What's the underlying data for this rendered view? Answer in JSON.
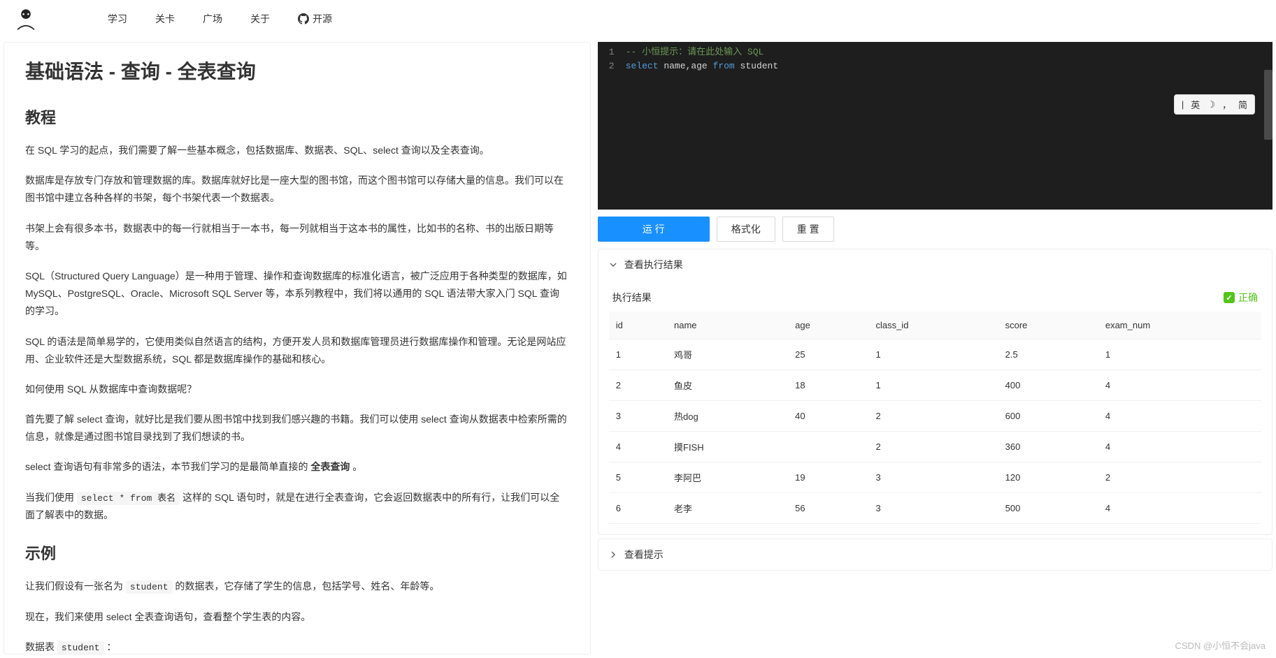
{
  "nav": {
    "links": [
      "学习",
      "关卡",
      "广场",
      "关于"
    ],
    "github": "开源"
  },
  "tutorial": {
    "title": "基础语法 - 查询 - 全表查询",
    "section1": "教程",
    "p1": "在 SQL 学习的起点，我们需要了解一些基本概念，包括数据库、数据表、SQL、select 查询以及全表查询。",
    "p2": "数据库是存放专门存放和管理数据的库。数据库就好比是一座大型的图书馆，而这个图书馆可以存储大量的信息。我们可以在图书馆中建立各种各样的书架，每个书架代表一个数据表。",
    "p3": "书架上会有很多本书，数据表中的每一行就相当于一本书，每一列就相当于这本书的属性，比如书的名称、书的出版日期等等。",
    "p4": "SQL（Structured Query Language）是一种用于管理、操作和查询数据库的标准化语言，被广泛应用于各种类型的数据库，如 MySQL、PostgreSQL、Oracle、Microsoft SQL Server 等，本系列教程中，我们将以通用的 SQL 语法带大家入门 SQL 查询的学习。",
    "p5": "SQL 的语法是简单易学的，它使用类似自然语言的结构，方便开发人员和数据库管理员进行数据库操作和管理。无论是网站应用、企业软件还是大型数据系统，SQL 都是数据库操作的基础和核心。",
    "p6": "如何使用 SQL 从数据库中查询数据呢？",
    "p7": "首先要了解 select 查询，就好比是我们要从图书馆中找到我们感兴趣的书籍。我们可以使用 select 查询从数据表中检索所需的信息，就像是通过图书馆目录找到了我们想读的书。",
    "p8_prefix": "select 查询语句有非常多的语法，本节我们学习的是最简单直接的 ",
    "p8_bold": "全表查询",
    "p8_suffix": " 。",
    "p9_prefix": "当我们使用 ",
    "p9_code": "select * from 表名",
    "p9_suffix": " 这样的 SQL 语句时，就是在进行全表查询，它会返回数据表中的所有行，让我们可以全面了解表中的数据。",
    "section2": "示例",
    "p10_prefix": "让我们假设有一张名为 ",
    "p10_code": "student",
    "p10_suffix": " 的数据表，它存储了学生的信息，包括学号、姓名、年龄等。",
    "p11": "现在，我们来使用 select 全表查询语句，查看整个学生表的内容。",
    "p12_prefix": "数据表 ",
    "p12_code": "student",
    "p12_suffix": " ："
  },
  "editor": {
    "line1_num": "1",
    "line1_comment": "-- 小恒提示：请在此处输入 SQL",
    "line2_num": "2",
    "line2_kw1": "select",
    "line2_mid": " name,age ",
    "line2_kw2": "from",
    "line2_end": " student"
  },
  "buttons": {
    "run": "运 行",
    "format": "格式化",
    "reset": "重 置"
  },
  "accordion": {
    "result_header": "查看执行结果",
    "hint_header": "查看提示"
  },
  "result": {
    "title": "执行结果",
    "status": "正确",
    "columns": [
      "id",
      "name",
      "age",
      "class_id",
      "score",
      "exam_num"
    ],
    "rows": [
      [
        "1",
        "鸡哥",
        "25",
        "1",
        "2.5",
        "1"
      ],
      [
        "2",
        "鱼皮",
        "18",
        "1",
        "400",
        "4"
      ],
      [
        "3",
        "热dog",
        "40",
        "2",
        "600",
        "4"
      ],
      [
        "4",
        "摸FISH",
        "",
        "2",
        "360",
        "4"
      ],
      [
        "5",
        "李阿巴",
        "19",
        "3",
        "120",
        "2"
      ],
      [
        "6",
        "老李",
        "56",
        "3",
        "500",
        "4"
      ]
    ]
  },
  "ime": {
    "t1": "英",
    "t2": "，",
    "t3": "简"
  },
  "watermark": "CSDN @小恒不会java"
}
